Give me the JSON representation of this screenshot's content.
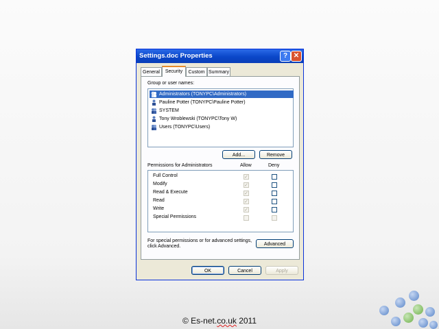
{
  "dialog": {
    "title": "Settings.doc Properties",
    "help_glyph": "?",
    "close_glyph": "✕"
  },
  "tabs": [
    "General",
    "Security",
    "Custom",
    "Summary"
  ],
  "security": {
    "group_label": "Group or user names:",
    "users": [
      "Administrators (TONYPC\\Administrators)",
      "Pauline Potter (TONYPC\\Pauline Potter)",
      "SYSTEM",
      "Tony Wroblewski (TONYPC\\Tony W)",
      "Users (TONYPC\\Users)"
    ],
    "add_label": "Add...",
    "remove_label": "Remove",
    "permissions_label": "Permissions for Administrators",
    "allow_header": "Allow",
    "deny_header": "Deny",
    "permissions": [
      {
        "name": "Full Control",
        "allow": true,
        "deny": false
      },
      {
        "name": "Modify",
        "allow": true,
        "deny": false
      },
      {
        "name": "Read & Execute",
        "allow": true,
        "deny": false
      },
      {
        "name": "Read",
        "allow": true,
        "deny": false
      },
      {
        "name": "Write",
        "allow": true,
        "deny": false
      },
      {
        "name": "Special Permissions",
        "allow": false,
        "deny": false
      }
    ],
    "advanced_text_line1": "For special permissions or for advanced settings,",
    "advanced_text_line2": "click Advanced.",
    "advanced_label": "Advanced"
  },
  "buttons": {
    "ok": "OK",
    "cancel": "Cancel",
    "apply": "Apply"
  },
  "footer": {
    "prefix": "© Es-net.",
    "squiggle": "co.uk",
    "suffix": " 2011"
  },
  "colors": {
    "titlebar": "#0a46c8",
    "selection": "#316ac5",
    "dialog_bg": "#ece9d8"
  }
}
